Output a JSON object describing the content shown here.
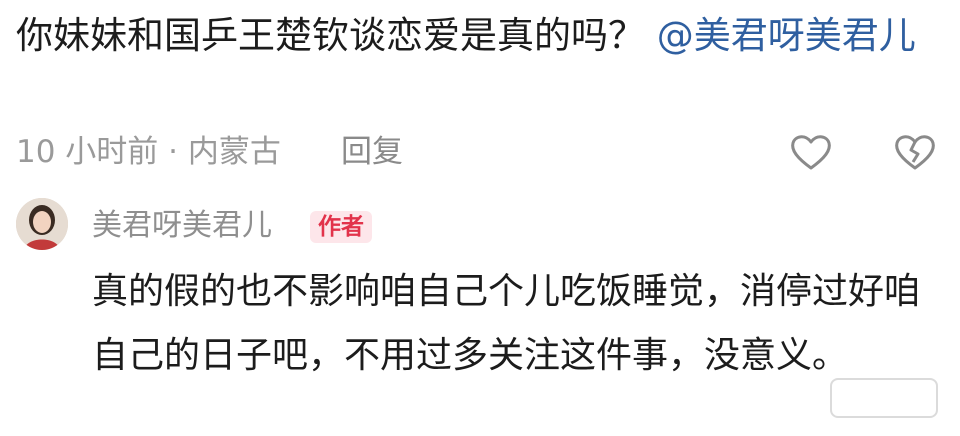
{
  "comment": {
    "text": "你妹妹和国乒王楚钦谈恋爱是真的吗？",
    "mention": "@美君呀美君儿",
    "meta": "10 小时前 · 内蒙古",
    "reply_label": "回复",
    "like_icon": "heart-outline-icon",
    "dislike_icon": "broken-heart-icon"
  },
  "reply": {
    "author": "美君呀美君儿",
    "badge": "作者",
    "text": "真的假的也不影响咱自己个儿吃饭睡觉，消停过好咱自己的日子吧，不用过多关注这件事，没意义。"
  },
  "watermark": "小红书",
  "colors": {
    "mention": "#2f5fa0",
    "badge_bg": "#fde6ea",
    "badge_text": "#e2334b",
    "meta": "#9a9a9a"
  }
}
